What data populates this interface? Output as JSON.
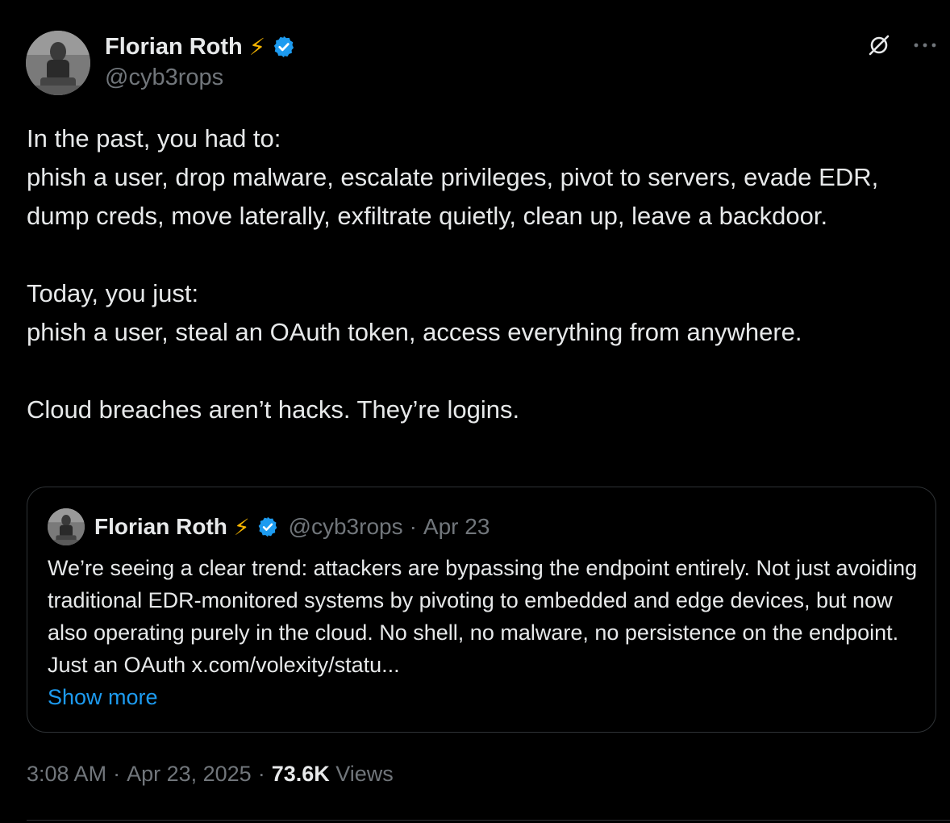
{
  "author": {
    "name": "Florian Roth",
    "handle": "@cyb3rops",
    "emoji": "⚡"
  },
  "tweet": {
    "paragraphs": [
      "In the past, you had to:",
      "phish a user, drop malware, escalate privileges, pivot to servers, evade EDR, dump creds, move laterally, exfiltrate quietly, clean up, leave a backdoor.",
      "Today, you just:",
      "phish a user, steal an OAuth token, access everything from anywhere.",
      "Cloud breaches aren’t hacks. They’re logins."
    ]
  },
  "quote": {
    "name": "Florian Roth",
    "emoji": "⚡",
    "handle": "@cyb3rops",
    "separator": "·",
    "date": "Apr 23",
    "text": "We’re seeing a clear trend: attackers are bypassing the endpoint entirely. Not just avoiding traditional EDR-monitored systems by pivoting to embedded and edge devices, but now also operating purely in the cloud. No shell, no malware, no persistence on the endpoint. Just an OAuth x.com/volexity/statu...",
    "show_more": "Show more"
  },
  "footer": {
    "time": "3:08 AM",
    "sep1": "·",
    "date": "Apr 23, 2025",
    "sep2": "·",
    "views_count": "73.6K",
    "views_label": "Views"
  },
  "icons": {
    "verified": "verified-badge-icon",
    "grok": "grok-icon",
    "more": "more-icon"
  },
  "colors": {
    "background": "#000000",
    "text": "#e7e9ea",
    "muted": "#71767b",
    "link": "#1d9bf0",
    "verified": "#1d9bf0",
    "border": "#2f3336"
  }
}
